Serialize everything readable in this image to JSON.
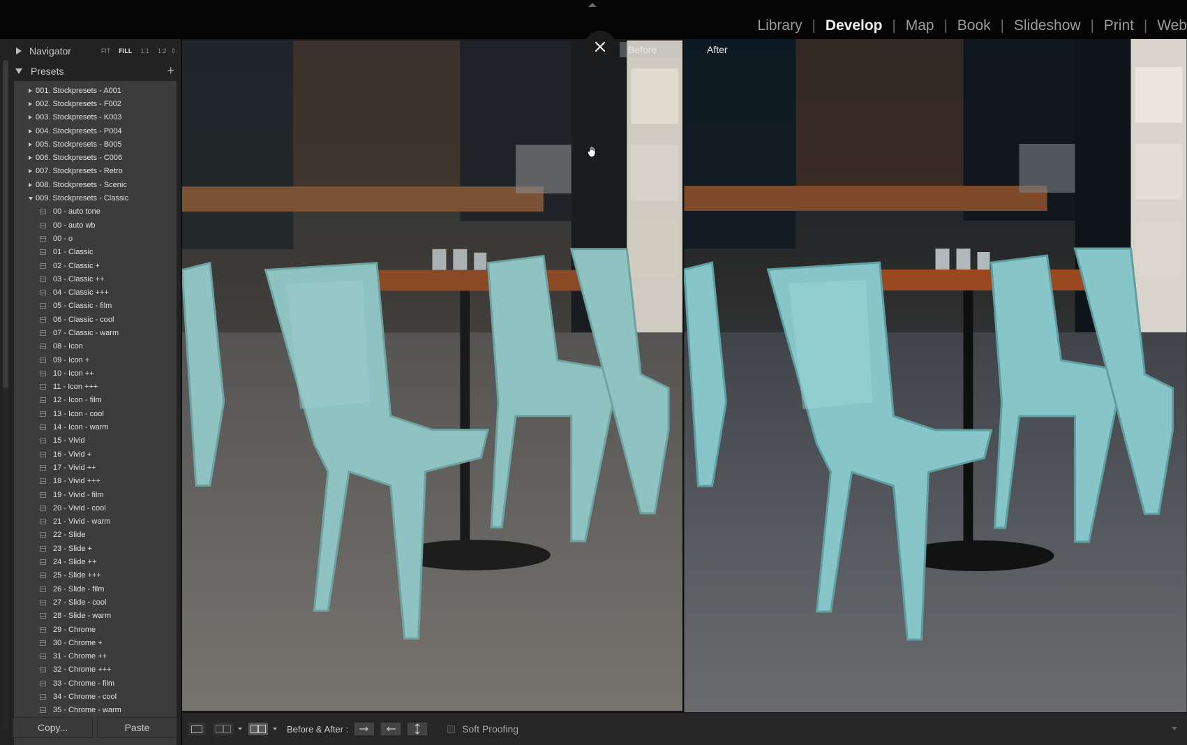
{
  "modules": [
    "Library",
    "Develop",
    "Map",
    "Book",
    "Slideshow",
    "Print",
    "Web"
  ],
  "active_module": "Develop",
  "navigator": {
    "title": "Navigator",
    "zoom_options": [
      "FIT",
      "FILL",
      "1:1",
      "1:2"
    ],
    "active_zoom": "FILL"
  },
  "presets": {
    "title": "Presets",
    "add_symbol": "+",
    "folders_collapsed": [
      "001. Stockpresets - A001",
      "002. Stockpresets - F002",
      "003. Stockpresets - K003",
      "004. Stockpresets - P004",
      "005. Stockpresets - B005",
      "006. Stockpresets - C006",
      "007. Stockpresets - Retro",
      "008. Stockpresets - Scenic"
    ],
    "open_folder": "009. Stockpresets - Classic",
    "items": [
      "00 - auto tone",
      "00 - auto wb",
      "00 - o",
      "01 - Classic",
      "02 - Classic +",
      "03 - Classic ++",
      "04 - Classic +++",
      "05 - Classic - film",
      "06 - Classic - cool",
      "07 - Classic - warm",
      "08 - Icon",
      "09 - Icon +",
      "10 - Icon ++",
      "11 - Icon +++",
      "12 - Icon - film",
      "13 - Icon - cool",
      "14 - Icon - warm",
      "15 - Vivid",
      "16 - Vivid +",
      "17 - Vivid ++",
      "18 - Vivid +++",
      "19 - Vivid - film",
      "20 - Vivid - cool",
      "21 - Vivid - warm",
      "22 - Slide",
      "23 - Slide +",
      "24 - Slide ++",
      "25 - Slide +++",
      "26 - Slide - film",
      "27 - Slide - cool",
      "28 - Slide - warm",
      "29 - Chrome",
      "30 - Chrome +",
      "31 - Chrome ++",
      "32 - Chrome +++",
      "33 - Chrome - film",
      "34 - Chrome - cool",
      "35 - Chrome - warm"
    ]
  },
  "buttons": {
    "copy": "Copy...",
    "paste": "Paste"
  },
  "view": {
    "before_label": "Before",
    "after_label": "After",
    "close_icon": "close-icon",
    "cursor_icon": "hand-cursor-icon"
  },
  "toolbar": {
    "before_after_label": "Before & After :",
    "soft_proofing_label": "Soft Proofing"
  }
}
